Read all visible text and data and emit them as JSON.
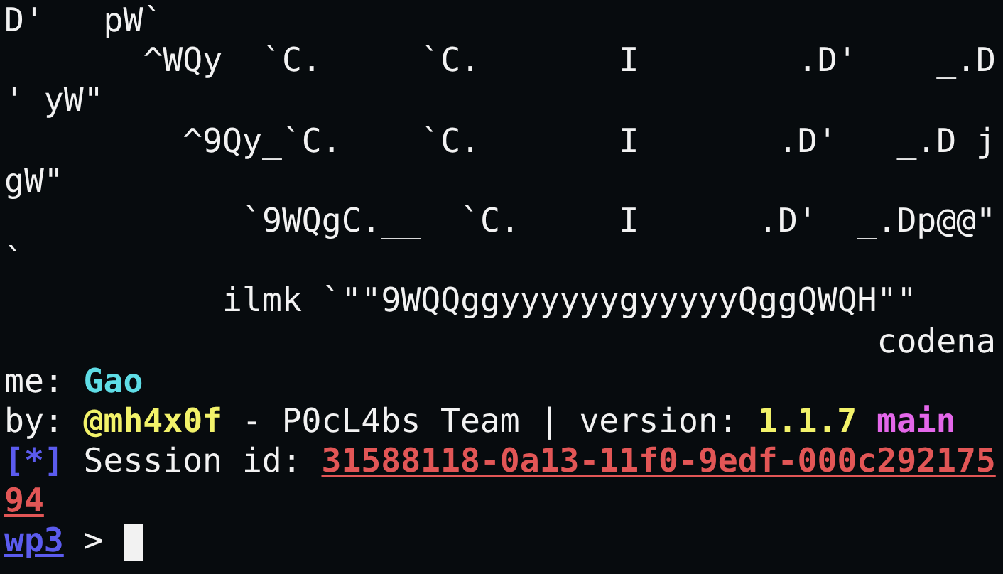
{
  "terminal": {
    "lines": [
      {
        "segments": [
          {
            "kind": "plain",
            "text": "D'   pW`"
          }
        ]
      },
      {
        "segments": [
          {
            "kind": "plain",
            "text": "       ^WQy  `C.     `C.       I        .D'    _.D"
          }
        ]
      },
      {
        "segments": [
          {
            "kind": "plain",
            "text": "' yW\""
          }
        ]
      },
      {
        "segments": [
          {
            "kind": "plain",
            "text": "         ^9Qy_`C.    `C.       I       .D'   _.D j"
          }
        ]
      },
      {
        "segments": [
          {
            "kind": "plain",
            "text": "gW\""
          }
        ]
      },
      {
        "segments": [
          {
            "kind": "plain",
            "text": "            `9WQgC.__  `C.     I      .D'  _.Dp@@\""
          }
        ]
      },
      {
        "segments": [
          {
            "kind": "plain",
            "text": "`"
          }
        ]
      },
      {
        "segments": [
          {
            "kind": "plain",
            "text": "           ilmk `\"\"9WQQggyyyyyygyyyyyQggQWQH\"\""
          }
        ]
      },
      {
        "segments": [
          {
            "kind": "plain",
            "text": "                                            codena"
          }
        ]
      },
      {
        "segments": [
          {
            "kind": "plain",
            "text": "me:"
          },
          {
            "kind": "cyan",
            "text": "Gao"
          }
        ]
      },
      {
        "segments": [
          {
            "kind": "plain",
            "text": "by:"
          },
          {
            "kind": "yellow",
            "text": "@mh4x0f"
          },
          {
            "kind": "plain",
            "text": "- P0cL4bs Team | version:"
          },
          {
            "kind": "yellow",
            "text": "1.1.7"
          },
          {
            "kind": "magenta",
            "text": "main"
          }
        ]
      },
      {
        "segments": [
          {
            "kind": "blue",
            "text": "[*]"
          },
          {
            "kind": "plain",
            "text": "Session id:"
          },
          {
            "kind": "session",
            "text": "31588118-0a13-11f0-9edf-000c292175"
          }
        ]
      },
      {
        "segments": [
          {
            "kind": "session",
            "text": "94"
          }
        ]
      }
    ],
    "prompt": {
      "text": "wp3",
      "symbol": ">"
    }
  }
}
